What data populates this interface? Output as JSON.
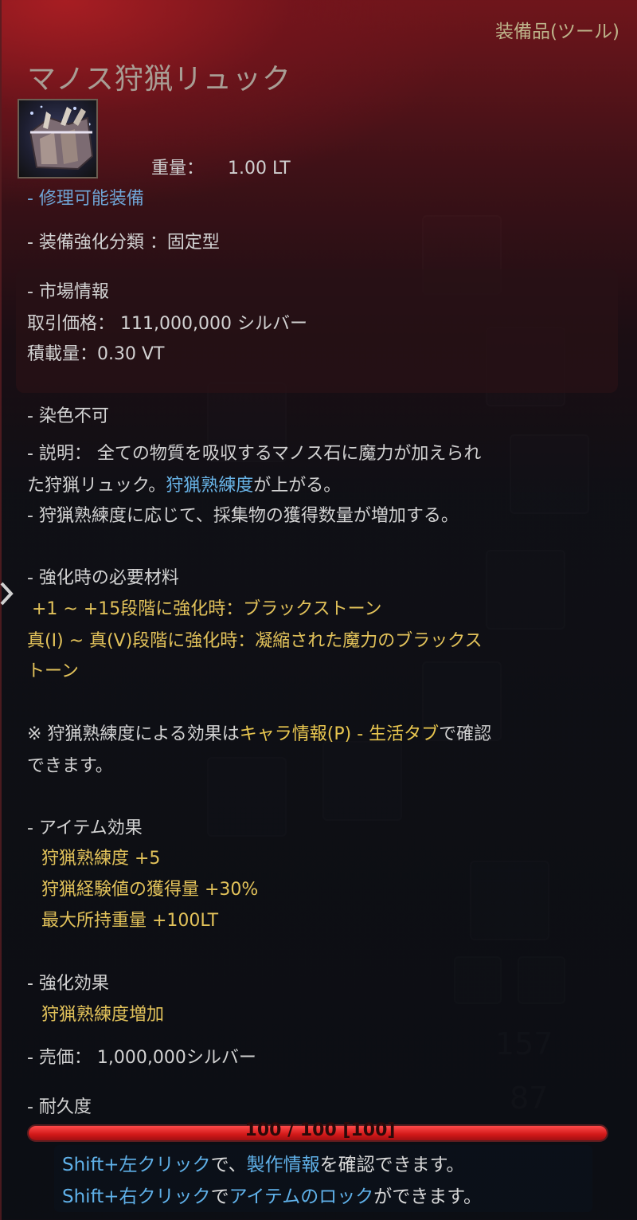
{
  "tooltip": {
    "category": "装備品(ツール)",
    "item_name": "マノス狩猟リュック",
    "icon": "hunting-backpack-icon",
    "weight_label": "重量：",
    "weight_value": "1.00 LT",
    "repairable": "- 修理可能装備",
    "enhance_type": "- 装備強化分類 ：固定型",
    "market": {
      "title": "- 市場情報",
      "price": "取引価格： 111,000,000 シルバー",
      "load": "積載量：0.30 VT"
    },
    "dye": "- 染色不可",
    "description": {
      "line1": "- 説明： 全ての物質を吸収するマノス石に魔力が加えられ",
      "line2_a": "た狩猟リュック。",
      "line2_b": "狩猟熟練度",
      "line2_c": "が上がる。",
      "line3": "- 狩猟熟練度に応じて、採集物の獲得数量が増加する。"
    },
    "materials": {
      "title": "- 強化時の必要材料",
      "line1": "+1 ~ +15段階に強化時：ブラックストーン",
      "line2": "真(I) ~ 真(V)段階に強化時：凝縮された魔力のブラックス",
      "line3": "トーン"
    },
    "note": {
      "a": "※ 狩猟熟練度による効果は",
      "b": "キャラ情報(P) - 生活タブ",
      "c": "で確認",
      "d": "できます。"
    },
    "item_effect": {
      "title": "- アイテム効果",
      "effects": [
        "狩猟熟練度 +5",
        "狩猟経験値の獲得量 +30%",
        "最大所持重量 +100LT"
      ]
    },
    "enhance_effect": {
      "title": "- 強化効果",
      "value": "狩猟熟練度増加"
    },
    "sell_price": "- 売価： 1,000,000シルバー",
    "durability": {
      "title": "- 耐久度",
      "text": "100 / 100 [100]",
      "fraction": 1.0
    },
    "hints": {
      "h1_a": "Shift+左クリック",
      "h1_b": "で、",
      "h1_c": "製作情報",
      "h1_d": "を確認できます。",
      "h2_a": "Shift+右クリック",
      "h2_b": "で",
      "h2_c": "アイテムのロック",
      "h2_d": "ができます。"
    }
  },
  "background": {
    "numbers": [
      "157",
      "87"
    ]
  },
  "colors": {
    "accent_blue": "#68b3e6",
    "accent_gold": "#e8c64f",
    "durability_red": "#e02020"
  }
}
